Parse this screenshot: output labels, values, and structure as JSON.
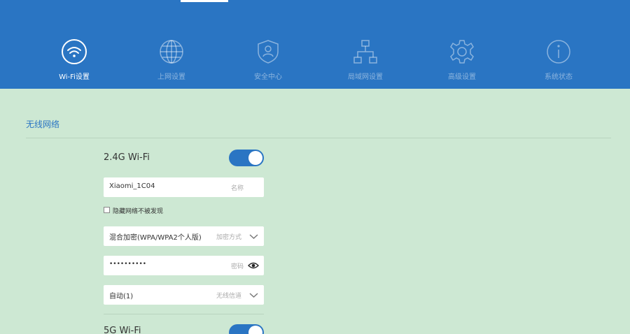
{
  "nav": {
    "items": [
      {
        "label": "Wi-Fi设置",
        "icon": "wifi-icon",
        "active": true
      },
      {
        "label": "上网设置",
        "icon": "globe-icon",
        "active": false
      },
      {
        "label": "安全中心",
        "icon": "shield-user-icon",
        "active": false
      },
      {
        "label": "局域网设置",
        "icon": "lan-network-icon",
        "active": false
      },
      {
        "label": "高级设置",
        "icon": "gear-icon",
        "active": false
      },
      {
        "label": "系统状态",
        "icon": "info-icon",
        "active": false
      }
    ]
  },
  "colors": {
    "header": "#2a75c3",
    "background": "#cde8d3",
    "accent": "#2a75c3"
  },
  "section": {
    "title": "无线网络"
  },
  "wifi24": {
    "label": "2.4G Wi-Fi",
    "enabled": true,
    "ssid": "Xiaomi_1C04",
    "ssid_hint": "名称",
    "hidden_label": "隐藏网络不被发现",
    "hidden_checked": false,
    "encryption": "混合加密(WPA/WPA2个人版)",
    "encryption_hint": "加密方式",
    "password_mask": "••••••••••",
    "password_hint": "密码",
    "channel": "自动(1)",
    "channel_hint": "无线信道"
  },
  "wifi5": {
    "label": "5G Wi-Fi",
    "enabled": true
  }
}
